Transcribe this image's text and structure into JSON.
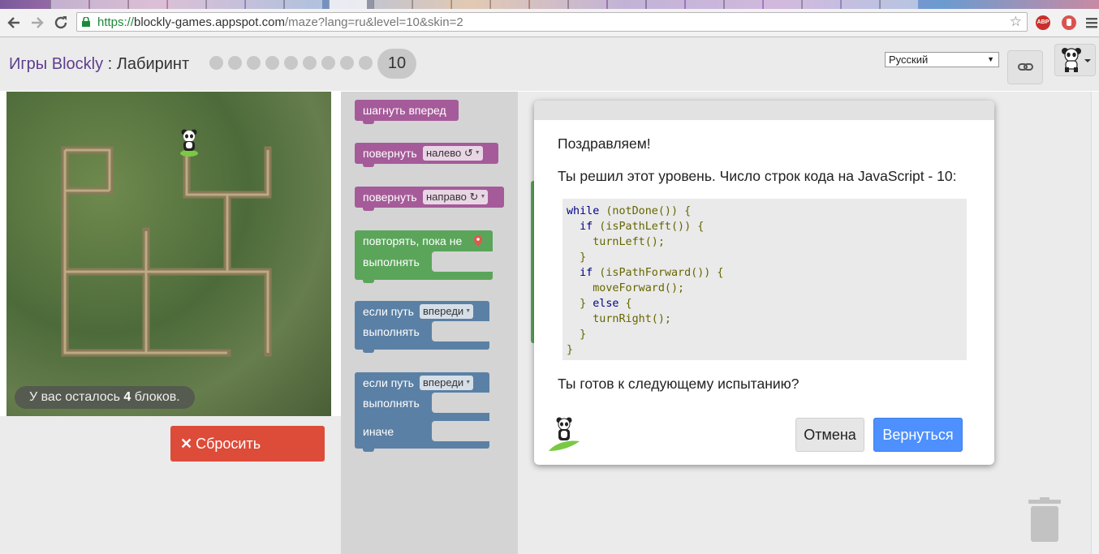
{
  "browser": {
    "url_scheme": "https://",
    "url_host": "blockly-games.appspot.com",
    "url_path": "/maze?lang=ru&level=10&skin=2",
    "ext_abp": "ABP"
  },
  "header": {
    "app_name": "Игры Blockly",
    "separator": " : ",
    "page_name": "Лабиринт",
    "current_level": "10",
    "language": "Русский"
  },
  "maze": {
    "blocks_left_prefix": "У вас осталось ",
    "blocks_left_count": "4",
    "blocks_left_suffix": " блоков."
  },
  "reset_button": {
    "icon": "✕",
    "label": "Сбросить"
  },
  "toolbox": {
    "move_forward": "шагнуть вперед",
    "turn": "повернуть",
    "turn_left_option": "налево ↺",
    "turn_right_option": "направо ↻",
    "repeat_until": "повторять, пока не",
    "do": "выполнять",
    "if_path": "если путь",
    "ahead_option": "впереди",
    "else": "иначе"
  },
  "dialog": {
    "congrats": "Поздравляем!",
    "solved": "Ты решил этот уровень. Число строк кода на JavaScript - 10:",
    "ready": "Ты готов к следующему испытанию?",
    "cancel_label": "Отмена",
    "return_label": "Вернуться",
    "code": [
      [
        "kw",
        "while"
      ],
      [
        "pn",
        " (notDone()) {\n  "
      ],
      [
        "kw",
        "if"
      ],
      [
        "pn",
        " (isPathLeft()) {\n    turnLeft();\n  }\n  "
      ],
      [
        "kw",
        "if"
      ],
      [
        "pn",
        " (isPathForward()) {\n    moveForward();\n  } "
      ],
      [
        "kw",
        "else"
      ],
      [
        "pn",
        " {\n    turnRight();\n  }\n}"
      ]
    ]
  },
  "colors": {
    "purple_block": "#a55b99",
    "green_block": "#5ba55b",
    "blue_block": "#5b80a5",
    "reset_red": "#dd4b39",
    "return_blue": "#4d90fe"
  }
}
